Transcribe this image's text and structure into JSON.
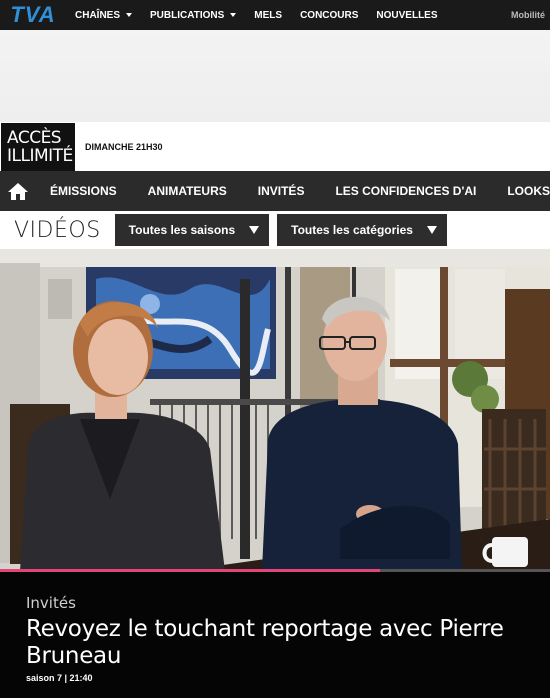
{
  "topbar": {
    "logo": "TVA",
    "nav": [
      {
        "label": "CHAÎNES",
        "dropdown": true
      },
      {
        "label": "PUBLICATIONS",
        "dropdown": true
      },
      {
        "label": "MELS",
        "dropdown": false
      },
      {
        "label": "CONCOURS",
        "dropdown": false
      },
      {
        "label": "NOUVELLES",
        "dropdown": false
      }
    ],
    "mobility": "Mobilité"
  },
  "show": {
    "logo_line1": "ACCÈS",
    "logo_line2": "ILLIMITÉ",
    "airtime": "DIMANCHE 21H30"
  },
  "mainnav": {
    "home_icon": "home-icon",
    "items": [
      "ÉMISSIONS",
      "ANIMATEURS",
      "INVITÉS",
      "LES CONFIDENCES D'AI",
      "LOOKS"
    ]
  },
  "videos": {
    "title": "VIDÉOS",
    "seasons_label": "Toutes les saisons",
    "categories_label": "Toutes les catégories"
  },
  "player": {
    "progress": 0.69
  },
  "caption": {
    "category": "Invités",
    "title": "Revoyez le touchant reportage avec Pierre Bruneau",
    "meta": "saison 7 | 21:40"
  },
  "colors": {
    "tva_blue": "#2f8fd8",
    "progress_pink": "#e0457b",
    "nav_bg": "#2b2b2b"
  }
}
